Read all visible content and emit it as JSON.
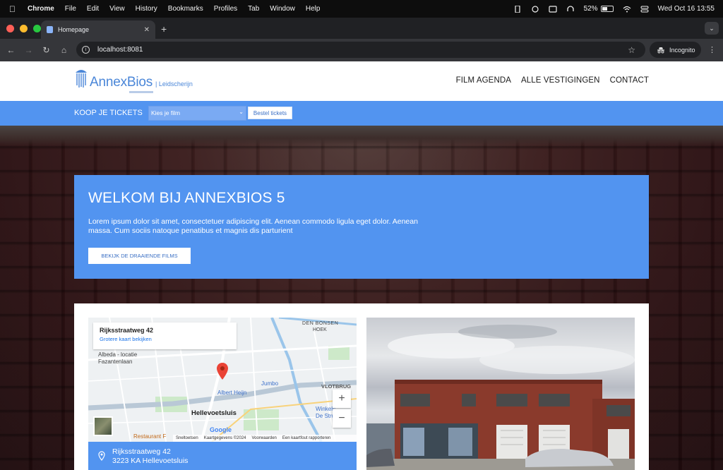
{
  "menubar": {
    "app": "Chrome",
    "items": [
      "File",
      "Edit",
      "View",
      "History",
      "Bookmarks",
      "Profiles",
      "Tab",
      "Window",
      "Help"
    ],
    "battery": "52%",
    "datetime": "Wed Oct 16  13:55"
  },
  "browser": {
    "tab_title": "Homepage",
    "url": "localhost:8081",
    "incognito_label": "Incognito"
  },
  "site": {
    "logo_text": "AnnexBios",
    "logo_location": "| Leidscherijn",
    "nav": [
      "FILM AGENDA",
      "ALLE VESTIGINGEN",
      "CONTACT"
    ],
    "ticketbar": {
      "label": "KOOP JE TICKETS",
      "select_value": "Kies je film",
      "button": "Bestel tickets"
    },
    "welcome": {
      "title": "WELKOM BIJ ANNEXBIOS 5",
      "text": "Lorem ipsum dolor sit amet, consectetuer adipiscing elit. Aenean commodo ligula eget dolor. Aenean massa. Cum sociis natoque penatibus et magnis dis parturient",
      "button": "BEKIJK DE DRAAIENDE FILMS"
    },
    "map": {
      "place_name": "Rijksstraatweg 42",
      "larger_map": "Grotere kaart bekijken",
      "labels": {
        "den_bonsen": "DEN BONSEN",
        "hoek": "HOEK",
        "albeda": "Albeda - locatie",
        "fazantenlaan": "Fazantenlaan",
        "albert_heijn": "Albert Heijn",
        "jumbo": "Jumbo",
        "vlotbrug": "VLOTBRUG",
        "hellevoetsluis": "Hellevoetsluis",
        "winkelcentrum": "Winkelc",
        "de_struyten": "De Stru",
        "restaurant": "Restaurant F"
      },
      "google": "Google",
      "footer": [
        "Sneltoetsen",
        "Kaartgegevens ©2024",
        "Voorwaarden",
        "Een kaartfout rapporteren"
      ]
    },
    "address": {
      "line1": "Rijksstraatweg 42",
      "line2": "3223 KA Hellevoetsluis"
    }
  },
  "colors": {
    "brand_blue": "#5294f0",
    "logo_blue": "#4a86d8"
  },
  "icons": {
    "pin": "location-pin-icon",
    "apple": "apple-icon"
  }
}
